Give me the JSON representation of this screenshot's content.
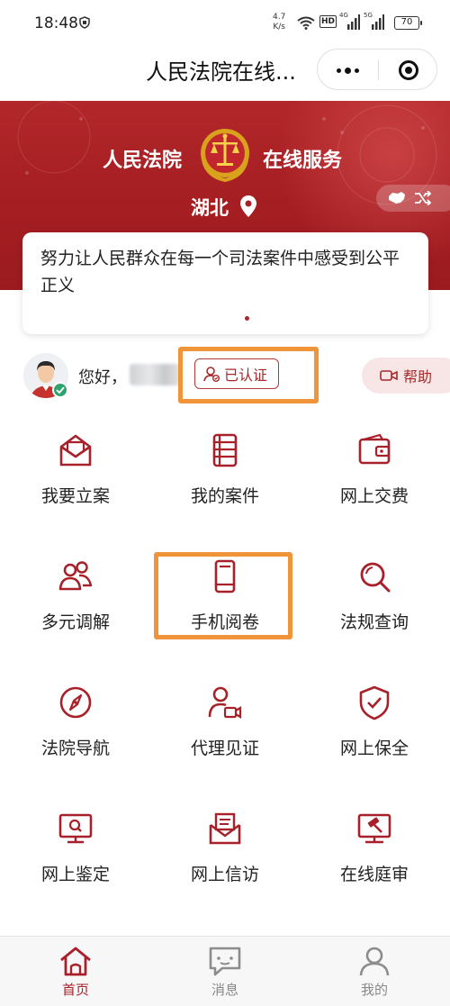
{
  "status_bar": {
    "time": "18:48",
    "net_speed_value": "4.7",
    "net_speed_unit": "K/s",
    "hd_label": "HD",
    "network_1": "4G",
    "network_2": "5G",
    "battery": "70"
  },
  "title_bar": {
    "title": "人民法院在线...",
    "more_icon": "more-dots-icon",
    "close_icon": "target-circle-icon"
  },
  "banner": {
    "court_label": "人民法院",
    "service_label": "在线服务",
    "region": "湖北",
    "colors": {
      "primary": "#a8212a",
      "accent": "#f0943a"
    }
  },
  "slogan": {
    "text": "努力让人民群众在每一个司法案件中感受到公平正义"
  },
  "user": {
    "greeting": "您好，",
    "name": "",
    "auth_status": "已认证",
    "help_label": "帮助"
  },
  "services": [
    {
      "label": "我要立案",
      "icon": "envelope-icon"
    },
    {
      "label": "我的案件",
      "icon": "notebook-icon"
    },
    {
      "label": "网上交费",
      "icon": "wallet-icon"
    },
    {
      "label": "多元调解",
      "icon": "people-icon"
    },
    {
      "label": "手机阅卷",
      "icon": "phone-icon"
    },
    {
      "label": "法规查询",
      "icon": "search-icon"
    },
    {
      "label": "法院导航",
      "icon": "compass-icon"
    },
    {
      "label": "代理见证",
      "icon": "person-camera-icon"
    },
    {
      "label": "网上保全",
      "icon": "shield-check-icon"
    },
    {
      "label": "网上鉴定",
      "icon": "monitor-search-icon"
    },
    {
      "label": "网上信访",
      "icon": "mail-letter-icon"
    },
    {
      "label": "在线庭审",
      "icon": "gavel-screen-icon"
    }
  ],
  "bottom_nav": {
    "items": [
      {
        "label": "首页",
        "icon": "home-icon",
        "active": true
      },
      {
        "label": "消息",
        "icon": "message-icon",
        "active": false
      },
      {
        "label": "我的",
        "icon": "user-icon",
        "active": false
      }
    ]
  }
}
